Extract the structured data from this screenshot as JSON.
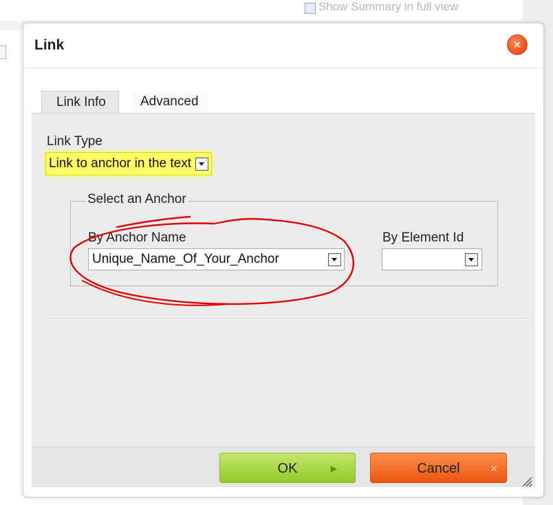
{
  "background": {
    "summary_text": "Show Summary in full view"
  },
  "dialog": {
    "title": "Link",
    "close_icon": "close-icon",
    "tabs": [
      {
        "label": "Link Info",
        "active": true
      },
      {
        "label": "Advanced",
        "active": false
      }
    ],
    "link_type": {
      "label": "Link Type",
      "selected": "Link to anchor in the text",
      "highlight_color": "#ffff66"
    },
    "anchor_section": {
      "legend": "Select an Anchor",
      "by_anchor_name_label": "By Anchor Name",
      "by_anchor_name_value": "Unique_Name_Of_Your_Anchor",
      "by_element_id_label": "By Element Id",
      "by_element_id_value": ""
    },
    "buttons": {
      "ok": "OK",
      "cancel": "Cancel"
    },
    "annotation_color": "#e00000"
  }
}
